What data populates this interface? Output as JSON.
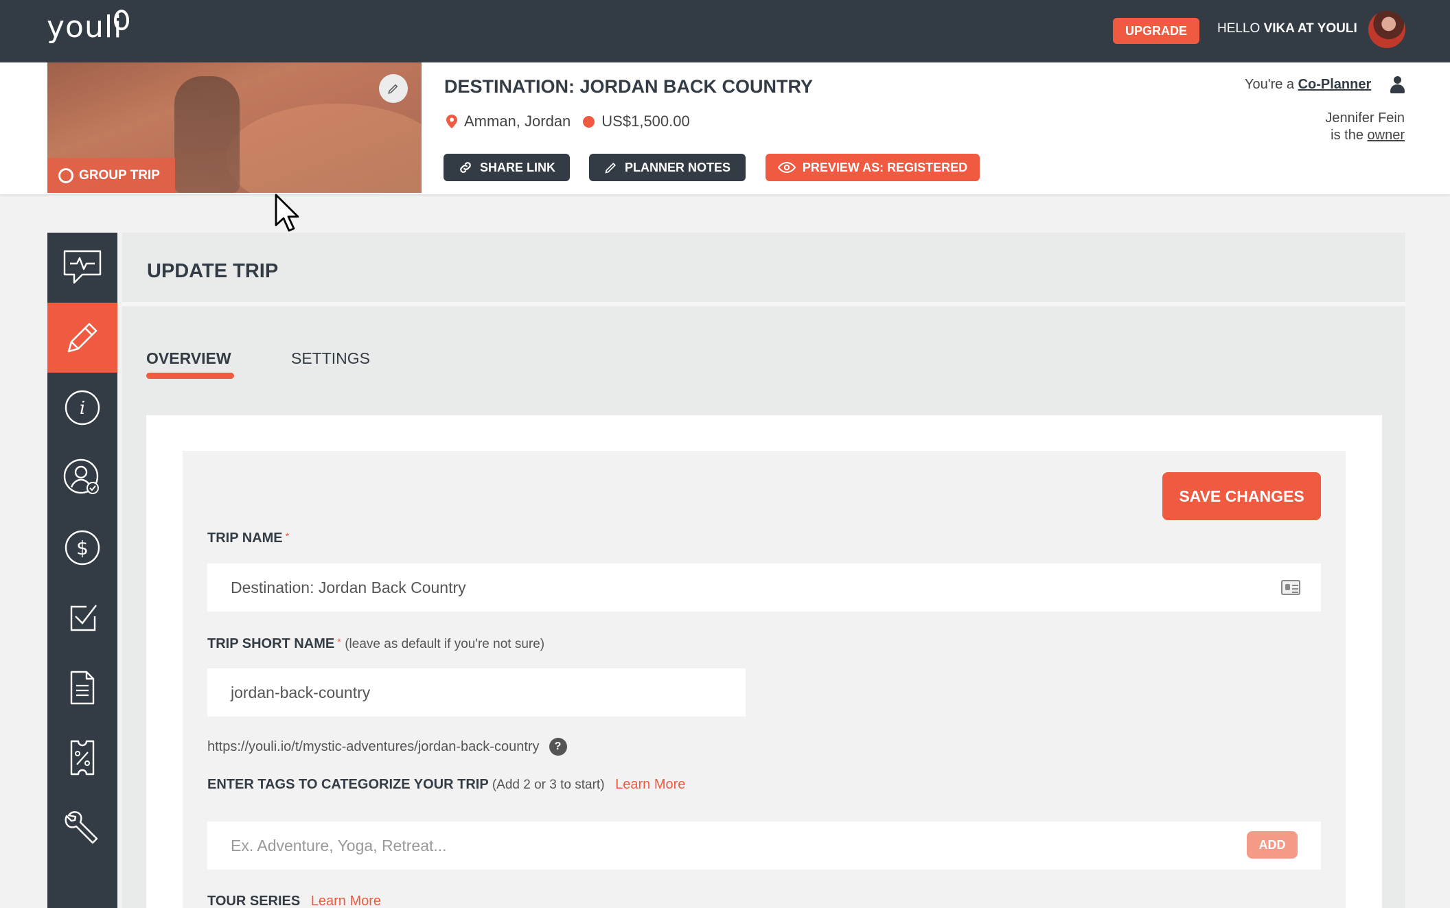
{
  "topnav": {
    "logo": "youli",
    "upgrade_label": "UPGRADE",
    "hello_prefix": "HELLO",
    "user_name": "VIKA AT YOULI"
  },
  "trip": {
    "title": "DESTINATION: JORDAN BACK COUNTRY",
    "location": "Amman, Jordan",
    "price": "US$1,500.00",
    "badge": "GROUP TRIP",
    "share_label": "SHARE LINK",
    "notes_label": "PLANNER NOTES",
    "preview_label": "PREVIEW AS: REGISTERED",
    "role_prefix": "You're a",
    "role": "Co-Planner",
    "owner_name": "Jennifer Fein",
    "owner_prefix": "is the",
    "owner_word": "owner"
  },
  "sidebar": {
    "items": [
      {
        "icon": "chat-activity-icon"
      },
      {
        "icon": "pencil-icon",
        "active": true
      },
      {
        "icon": "info-icon"
      },
      {
        "icon": "user-check-icon"
      },
      {
        "icon": "dollar-icon"
      },
      {
        "icon": "checkbox-icon"
      },
      {
        "icon": "document-icon"
      },
      {
        "icon": "discount-ticket-icon"
      },
      {
        "icon": "wrench-icon"
      }
    ]
  },
  "main": {
    "title": "UPDATE TRIP",
    "tabs": [
      {
        "label": "OVERVIEW",
        "active": true
      },
      {
        "label": "SETTINGS",
        "active": false
      }
    ],
    "save_label": "SAVE CHANGES"
  },
  "form": {
    "trip_name_label": "TRIP NAME",
    "trip_name_value": "Destination: Jordan Back Country",
    "short_name_label": "TRIP SHORT NAME",
    "short_name_hint": "(leave as default if you're not sure)",
    "short_name_value": "jordan-back-country",
    "url": "https://youli.io/t/mystic-adventures/jordan-back-country",
    "help": "?",
    "tags_label": "ENTER TAGS TO CATEGORIZE YOUR TRIP",
    "tags_hint": "(Add 2 or 3 to start)",
    "learn_more": "Learn More",
    "tags_placeholder": "Ex. Adventure, Yoga, Retreat...",
    "add_label": "ADD",
    "tour_series_label": "TOUR SERIES",
    "tour_learn_more": "Learn More",
    "required_mark": "*"
  },
  "colors": {
    "brand": "#ef5a40",
    "dark": "#333c44"
  }
}
